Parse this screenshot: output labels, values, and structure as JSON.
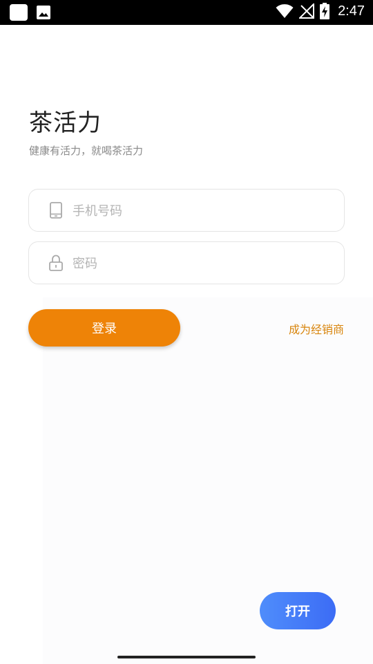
{
  "status_bar": {
    "time": "2:47",
    "icons": [
      "square-notification-icon",
      "image-notification-icon",
      "wifi-icon",
      "no-signal-icon",
      "battery-charging-icon"
    ]
  },
  "login": {
    "title": "茶活力",
    "subtitle": "健康有活力，就喝茶活力",
    "phone_placeholder": "手机号码",
    "password_placeholder": "密码",
    "login_button": "登录",
    "dealer_link": "成为经销商"
  },
  "floating": {
    "open_button": "打开"
  },
  "colors": {
    "accent_orange": "#ee8307",
    "link_orange": "#d8840b",
    "open_blue": "#4577f8"
  }
}
